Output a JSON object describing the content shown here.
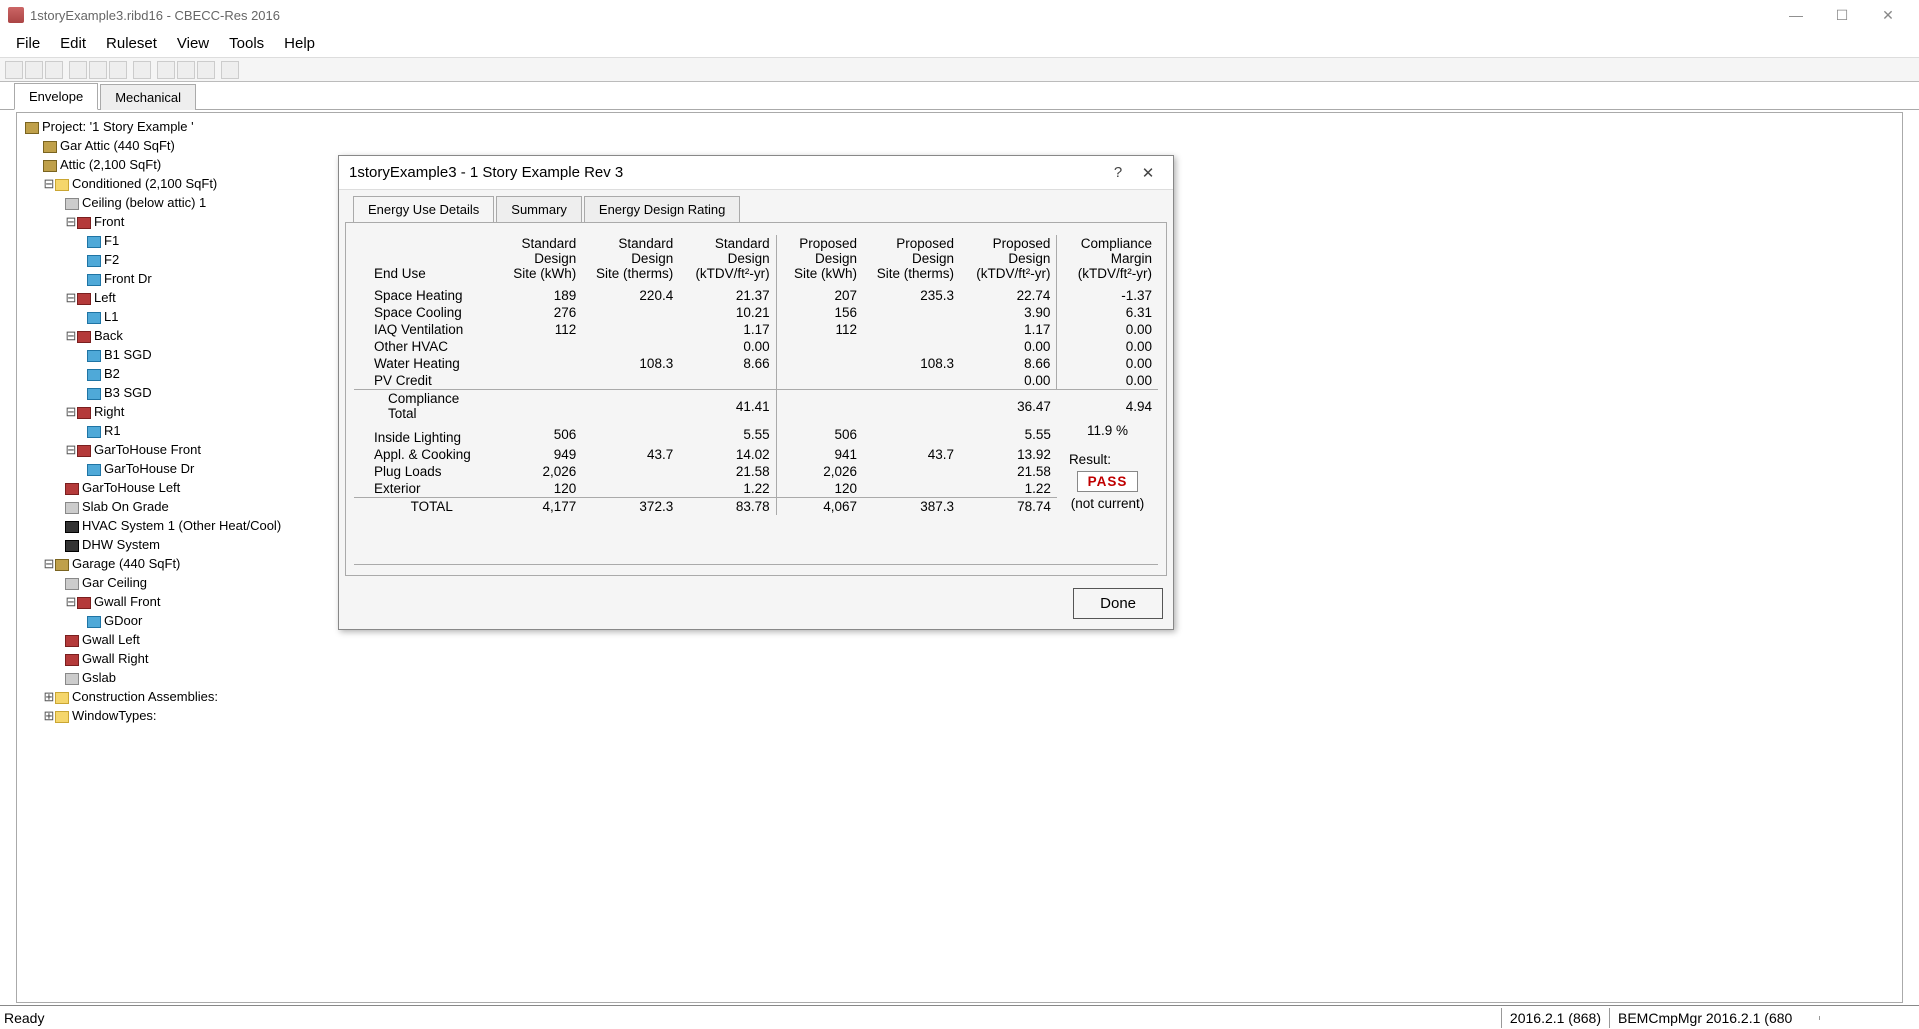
{
  "window": {
    "title": "1storyExample3.ribd16 - CBECC-Res 2016"
  },
  "menu": [
    "File",
    "Edit",
    "Ruleset",
    "View",
    "Tools",
    "Help"
  ],
  "tabs": {
    "envelope": "Envelope",
    "mechanical": "Mechanical"
  },
  "tree": {
    "project": "Project:   '1 Story Example '",
    "gar_attic": "Gar Attic   (440 SqFt)",
    "attic": "Attic   (2,100 SqFt)",
    "conditioned": "Conditioned  (2,100 SqFt)",
    "ceiling": "Ceiling (below attic) 1",
    "front": "Front",
    "f1": "F1",
    "f2": "F2",
    "front_dr": "Front Dr",
    "left": "Left",
    "l1": "L1",
    "back": "Back",
    "b1": "B1 SGD",
    "b2": "B2",
    "b3": "B3 SGD",
    "right": "Right",
    "r1": "R1",
    "gth_front": "GarToHouse Front",
    "gth_dr": "GarToHouse Dr",
    "gth_left": "GarToHouse Left",
    "slab": "Slab On Grade",
    "hvac": "HVAC System 1  (Other Heat/Cool)",
    "dhw": "DHW System",
    "garage": "Garage  (440 SqFt)",
    "gar_ceil": "Gar Ceiling",
    "gwall_front": "Gwall Front",
    "gdoor": "GDoor",
    "gwall_left": "Gwall Left",
    "gwall_right": "Gwall Right",
    "gslab": "Gslab",
    "constr": "Construction Assemblies:",
    "wintypes": "WindowTypes:"
  },
  "dialog": {
    "title": "1storyExample3 - 1 Story Example Rev 3",
    "tabs": {
      "details": "Energy Use Details",
      "summary": "Summary",
      "rating": "Energy Design Rating"
    },
    "headers": {
      "enduse": "End Use",
      "sd_kwh": "Standard\nDesign\nSite (kWh)",
      "sd_therm": "Standard\nDesign\nSite (therms)",
      "sd_ktdv": "Standard\nDesign\n(kTDV/ft²-yr)",
      "pd_kwh": "Proposed\nDesign\nSite (kWh)",
      "pd_therm": "Proposed\nDesign\nSite (therms)",
      "pd_ktdv": "Proposed\nDesign\n(kTDV/ft²-yr)",
      "margin": "Compliance\nMargin\n(kTDV/ft²-yr)"
    },
    "rows": {
      "space_heating": {
        "label": "Space Heating",
        "sd_kwh": "189",
        "sd_therm": "220.4",
        "sd_ktdv": "21.37",
        "pd_kwh": "207",
        "pd_therm": "235.3",
        "pd_ktdv": "22.74",
        "margin": "-1.37"
      },
      "space_cooling": {
        "label": "Space Cooling",
        "sd_kwh": "276",
        "sd_therm": "",
        "sd_ktdv": "10.21",
        "pd_kwh": "156",
        "pd_therm": "",
        "pd_ktdv": "3.90",
        "margin": "6.31"
      },
      "iaq": {
        "label": "IAQ Ventilation",
        "sd_kwh": "112",
        "sd_therm": "",
        "sd_ktdv": "1.17",
        "pd_kwh": "112",
        "pd_therm": "",
        "pd_ktdv": "1.17",
        "margin": "0.00"
      },
      "other_hvac": {
        "label": "Other HVAC",
        "sd_kwh": "",
        "sd_therm": "",
        "sd_ktdv": "0.00",
        "pd_kwh": "",
        "pd_therm": "",
        "pd_ktdv": "0.00",
        "margin": "0.00"
      },
      "water_heating": {
        "label": "Water Heating",
        "sd_kwh": "",
        "sd_therm": "108.3",
        "sd_ktdv": "8.66",
        "pd_kwh": "",
        "pd_therm": "108.3",
        "pd_ktdv": "8.66",
        "margin": "0.00"
      },
      "pv_credit": {
        "label": "PV Credit",
        "sd_kwh": "",
        "sd_therm": "",
        "sd_ktdv": "",
        "pd_kwh": "",
        "pd_therm": "",
        "pd_ktdv": "0.00",
        "margin": "0.00"
      },
      "compliance_total": {
        "label": "Compliance Total",
        "sd_ktdv": "41.41",
        "pd_ktdv": "36.47",
        "margin": "4.94"
      },
      "inside_lighting": {
        "label": "Inside Lighting",
        "sd_kwh": "506",
        "sd_therm": "",
        "sd_ktdv": "5.55",
        "pd_kwh": "506",
        "pd_therm": "",
        "pd_ktdv": "5.55"
      },
      "appl": {
        "label": "Appl. & Cooking",
        "sd_kwh": "949",
        "sd_therm": "43.7",
        "sd_ktdv": "14.02",
        "pd_kwh": "941",
        "pd_therm": "43.7",
        "pd_ktdv": "13.92"
      },
      "plug": {
        "label": "Plug Loads",
        "sd_kwh": "2,026",
        "sd_therm": "",
        "sd_ktdv": "21.58",
        "pd_kwh": "2,026",
        "pd_therm": "",
        "pd_ktdv": "21.58"
      },
      "exterior": {
        "label": "Exterior",
        "sd_kwh": "120",
        "sd_therm": "",
        "sd_ktdv": "1.22",
        "pd_kwh": "120",
        "pd_therm": "",
        "pd_ktdv": "1.22"
      },
      "total": {
        "label": "TOTAL",
        "sd_kwh": "4,177",
        "sd_therm": "372.3",
        "sd_ktdv": "83.78",
        "pd_kwh": "4,067",
        "pd_therm": "387.3",
        "pd_ktdv": "78.74"
      }
    },
    "percent": "11.9 %",
    "result_label": "Result:",
    "result_value": "PASS",
    "result_note": "(not current)",
    "done": "Done"
  },
  "status": {
    "ready": "Ready",
    "ver1": "2016.2.1 (868)",
    "ver2": "BEMCmpMgr 2016.2.1 (680"
  }
}
